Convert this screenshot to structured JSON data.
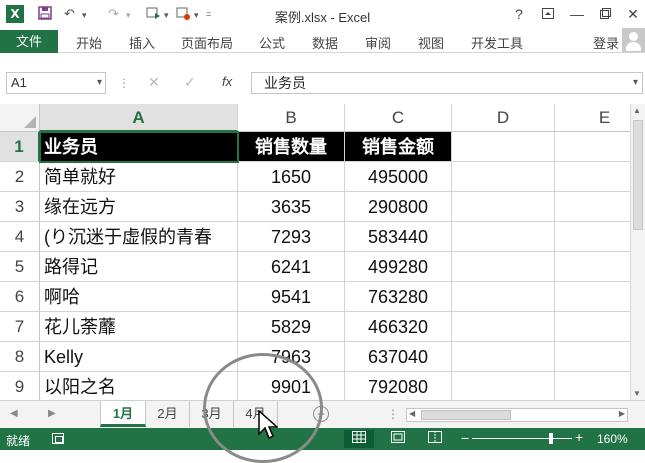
{
  "window": {
    "title": "案例.xlsx - Excel",
    "app_icon": "X",
    "help": "?",
    "minimize": "—",
    "close": "✕"
  },
  "ribbon": {
    "file_tab": "文件",
    "tabs": [
      "开始",
      "插入",
      "页面布局",
      "公式",
      "数据",
      "审阅",
      "视图",
      "开发工具"
    ],
    "login": "登录"
  },
  "formula_bar": {
    "name_box": "A1",
    "formula": "业务员"
  },
  "grid": {
    "columns": [
      "A",
      "B",
      "C",
      "D",
      "E"
    ],
    "rows": [
      "1",
      "2",
      "3",
      "4",
      "5",
      "6",
      "7",
      "8",
      "9"
    ],
    "data": [
      [
        "业务员",
        "销售数量",
        "销售金额"
      ],
      [
        "简单就好",
        "1650",
        "495000"
      ],
      [
        "缘在远方",
        "3635",
        "290800"
      ],
      [
        "(り沉迷于虚假的青春",
        "7293",
        "583440"
      ],
      [
        "路得记",
        "6241",
        "499280"
      ],
      [
        "啊哈",
        "9541",
        "763280"
      ],
      [
        "花儿荼蘼",
        "5829",
        "466320"
      ],
      [
        "Kelly",
        "7963",
        "637040"
      ],
      [
        "以阳之名",
        "9901",
        "792080"
      ]
    ]
  },
  "sheets": {
    "tabs": [
      "1月",
      "2月",
      "3月",
      "4月"
    ],
    "active": "1月",
    "add": "+"
  },
  "status": {
    "text": "就绪",
    "zoom": "160%"
  },
  "colors": {
    "excel_green": "#217346",
    "header_fill": "#000000"
  }
}
